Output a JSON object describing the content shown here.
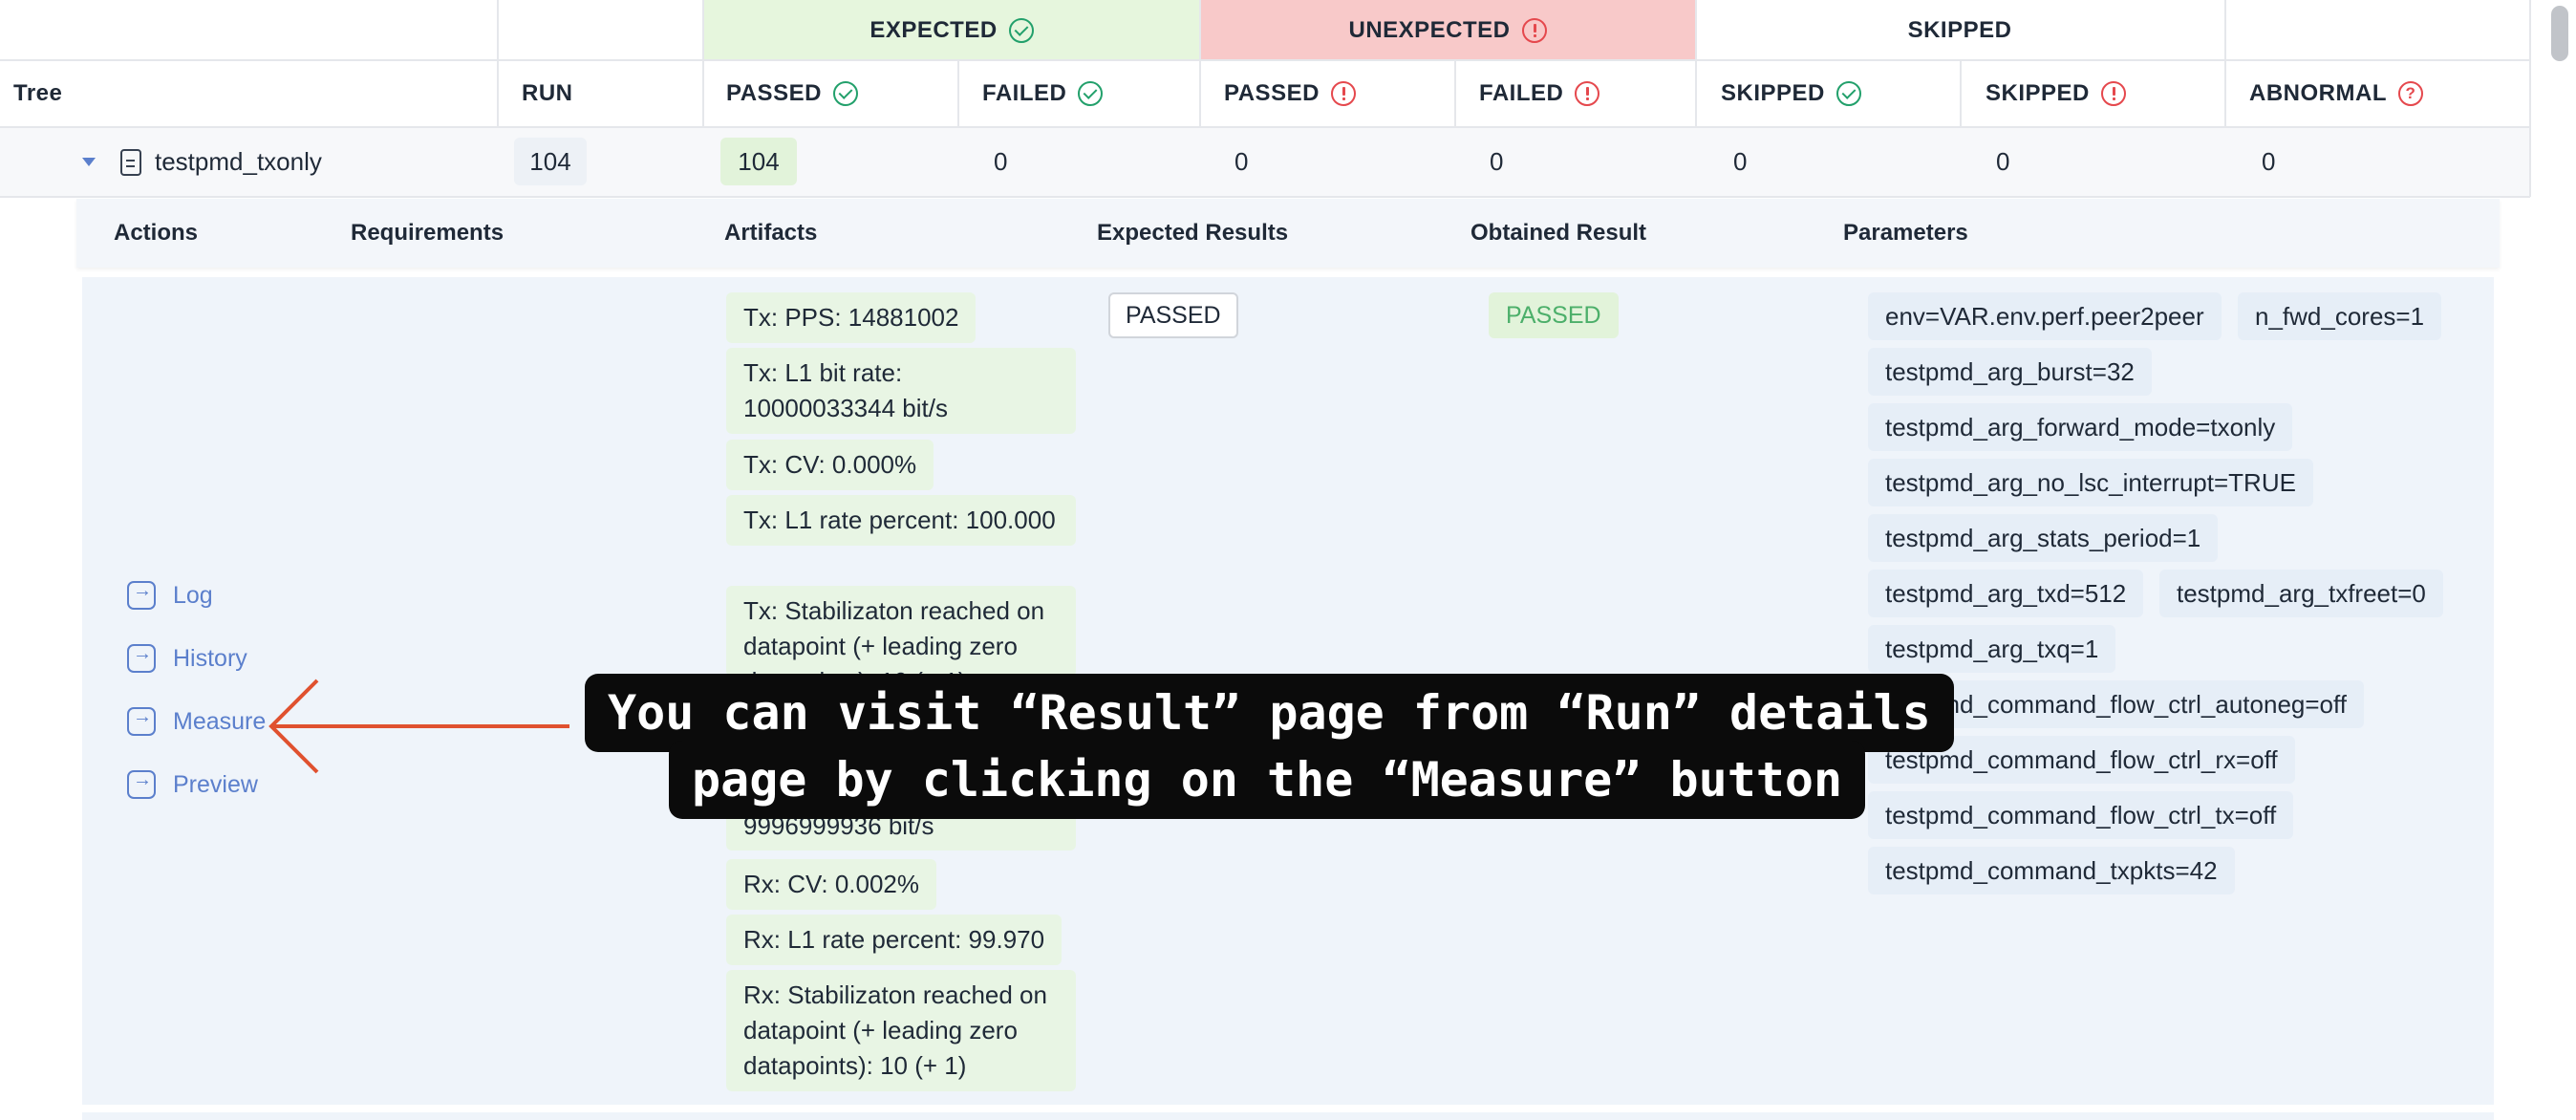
{
  "group_headers": {
    "expected": "EXPECTED",
    "unexpected": "UNEXPECTED",
    "skipped": "SKIPPED"
  },
  "columns": {
    "tree": "Tree",
    "run": "RUN",
    "passed_expected": "PASSED",
    "failed_expected": "FAILED",
    "passed_unexpected": "PASSED",
    "failed_unexpected": "FAILED",
    "skipped_expected": "SKIPPED",
    "skipped_unexpected": "SKIPPED",
    "abnormal": "ABNORMAL"
  },
  "row": {
    "name": "testpmd_txonly",
    "run": "104",
    "passed_expected": "104",
    "failed_expected": "0",
    "passed_unexpected": "0",
    "failed_unexpected": "0",
    "skipped_expected": "0",
    "skipped_unexpected": "0",
    "abnormal": "0"
  },
  "details_headers": {
    "actions": "Actions",
    "requirements": "Requirements",
    "artifacts": "Artifacts",
    "expected_results": "Expected Results",
    "obtained_result": "Obtained Result",
    "parameters": "Parameters"
  },
  "actions": {
    "log": "Log",
    "history": "History",
    "measure": "Measure",
    "preview": "Preview"
  },
  "artifacts": [
    "Tx: PPS: 14881002",
    "Tx: L1 bit rate: 10000033344 bit/s",
    "Tx: CV: 0.000%",
    "Tx: L1 rate percent: 100.000",
    "Tx: Stabilizaton reached on datapoint (+ leading zero datapoints): 10 (+ 1)",
    "9996999936 bit/s",
    "Rx: CV: 0.002%",
    "Rx: L1 rate percent: 99.970",
    "Rx: Stabilizaton reached on datapoint (+ leading zero datapoints): 10 (+ 1)"
  ],
  "expected_result": "PASSED",
  "obtained_result": "PASSED",
  "parameters": [
    "env=VAR.env.perf.peer2peer",
    "n_fwd_cores=1",
    "testpmd_arg_burst=32",
    "testpmd_arg_forward_mode=txonly",
    "testpmd_arg_no_lsc_interrupt=TRUE",
    "testpmd_arg_stats_period=1",
    "testpmd_arg_txd=512",
    "testpmd_arg_txfreet=0",
    "testpmd_arg_txq=1",
    "testpmd_command_flow_ctrl_autoneg=off",
    "testpmd_command_flow_ctrl_rx=off",
    "testpmd_command_flow_ctrl_tx=off",
    "testpmd_command_txpkts=42"
  ],
  "overlay": {
    "line1": "You can visit “Result” page from “Run” details",
    "line2": "page by clicking on the “Measure” button"
  },
  "colors": {
    "expected_bg": "#e6f6dd",
    "unexpected_bg": "#f8c9c9",
    "details_bg": "#eff4fa",
    "accent": "#5b7fcc",
    "arrow": "#e0512f"
  }
}
